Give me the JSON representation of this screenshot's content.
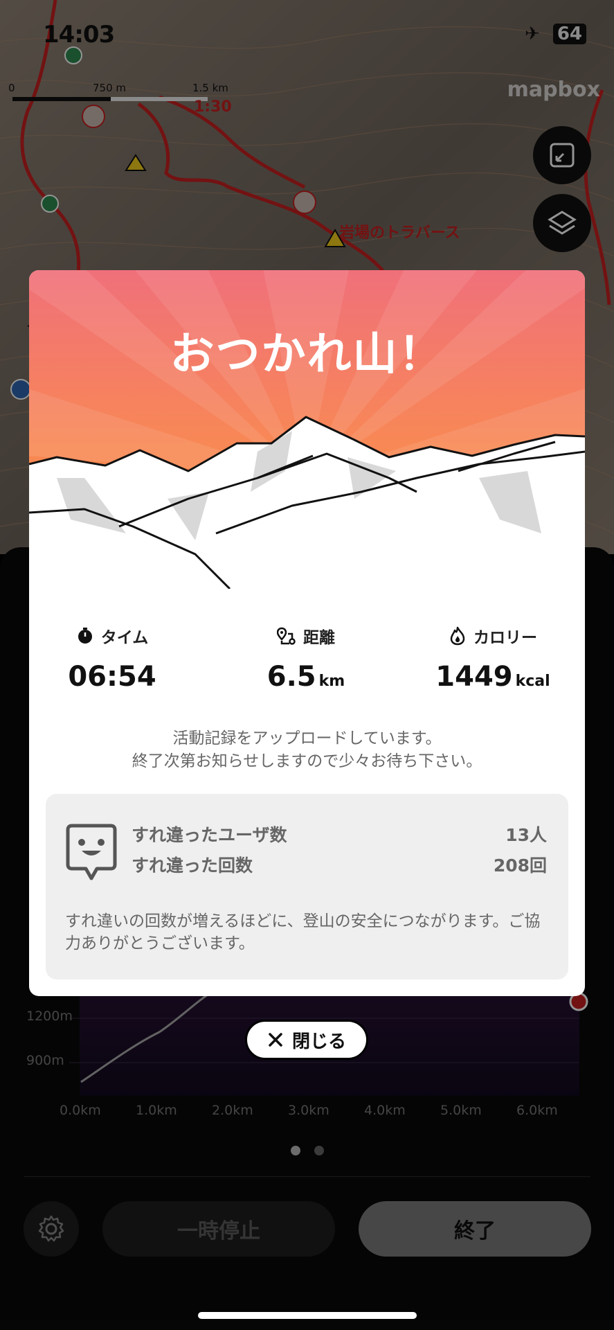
{
  "status_bar": {
    "time": "14:03",
    "battery": "64"
  },
  "map": {
    "attribution": "mapbox",
    "scale_labels": [
      "0",
      "750 m",
      "1.5 km"
    ],
    "place_label": "岩場のトラバース",
    "route_time_label": "1:30",
    "colors": {
      "route": "#c62020",
      "terrain": "#8c7f72"
    }
  },
  "modal": {
    "title": "おつかれ山！",
    "stats": [
      {
        "icon": "stopwatch-icon",
        "label": "タイム",
        "value": "06:54",
        "unit": ""
      },
      {
        "icon": "route-pin-icon",
        "label": "距離",
        "value": "6.5",
        "unit": "km"
      },
      {
        "icon": "flame-icon",
        "label": "カロリー",
        "value": "1449",
        "unit": "kcal"
      }
    ],
    "upload_message_line1": "活動記録をアップロードしています。",
    "upload_message_line2": "終了次第お知らせしますので少々お待ち下さい。",
    "encounter": {
      "users_label": "すれ違ったユーザ数",
      "users_value": "13人",
      "count_label": "すれ違った回数",
      "count_value": "208回",
      "note": "すれ違いの回数が増えるほどに、登山の安全につながります。ご協力ありがとうございます。"
    },
    "close_label": "閉じる",
    "colors": {
      "sunset_top": "#f27a6e",
      "sunset_bottom": "#fb8a3e",
      "box": "#efefef"
    }
  },
  "elevation_graph": {
    "y_labels": [
      "1200m",
      "900m"
    ],
    "x_labels": [
      "0.0km",
      "1.0km",
      "2.0km",
      "3.0km",
      "4.0km",
      "5.0km",
      "6.0km"
    ]
  },
  "controls": {
    "pause_label": "一時停止",
    "end_label": "終了",
    "page_dots": 2,
    "active_page": 1
  }
}
